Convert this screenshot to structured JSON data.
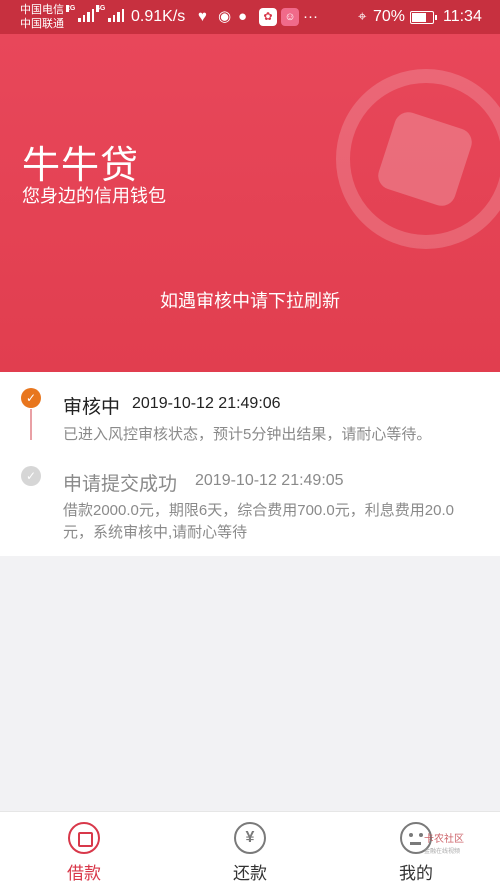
{
  "status_bar": {
    "carrier_1": "中国电信",
    "carrier_2": "中国联通",
    "net_1": "2G",
    "net_2": "4G",
    "speed": "0.91K/s",
    "icons": [
      "heart-pulse-icon",
      "wechat-icon",
      "chat-bubble-icon",
      "app-badge-icon",
      "app-badge-icon-2",
      "more-dots-icon"
    ],
    "more": "···",
    "battery": "70%",
    "battery_level": 0.7,
    "time": "11:34"
  },
  "hero": {
    "title": "牛牛贷",
    "subtitle": "您身边的信用钱包",
    "hint": "如遇审核中请下拉刷新",
    "color": "#e4434f"
  },
  "timeline": [
    {
      "status": "审核中",
      "time": "2019-10-12 21:49:06",
      "description": "已进入风控审核状态，预计5分钟出结果，请耐心等待。",
      "active": true
    },
    {
      "status": "申请提交成功",
      "time": "2019-10-12 21:49:05",
      "description": "借款2000.0元，期限6天，综合费用700.0元，利息费用20.0元，系统审核中,请耐心等待",
      "active": false
    }
  ],
  "bottom_nav": {
    "items": [
      {
        "label": "借款",
        "icon": "loan-icon",
        "active": true
      },
      {
        "label": "还款",
        "icon": "repay-yen-icon",
        "active": false
      },
      {
        "label": "我的",
        "icon": "profile-face-icon",
        "active": false
      }
    ],
    "accent": "#d8384a",
    "yen": "¥"
  },
  "watermark": {
    "text": "卡农社区",
    "sub": "金融在线视频"
  }
}
